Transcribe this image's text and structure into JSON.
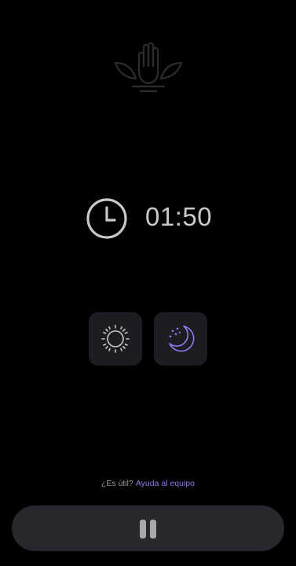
{
  "icons": {
    "logo": "lotus-hand-icon",
    "clock": "clock-icon",
    "day_mode": "sun-icon",
    "night_mode": "moon-stars-icon",
    "pause": "pause-icon"
  },
  "timer": {
    "value": "01:50"
  },
  "helper": {
    "question": "¿Es útil?",
    "link": "Ayuda al equipo"
  },
  "colors": {
    "background": "#000000",
    "button_bg": "#1c1d22",
    "bar_bg": "#27282d",
    "accent": "#8e7cf0"
  }
}
